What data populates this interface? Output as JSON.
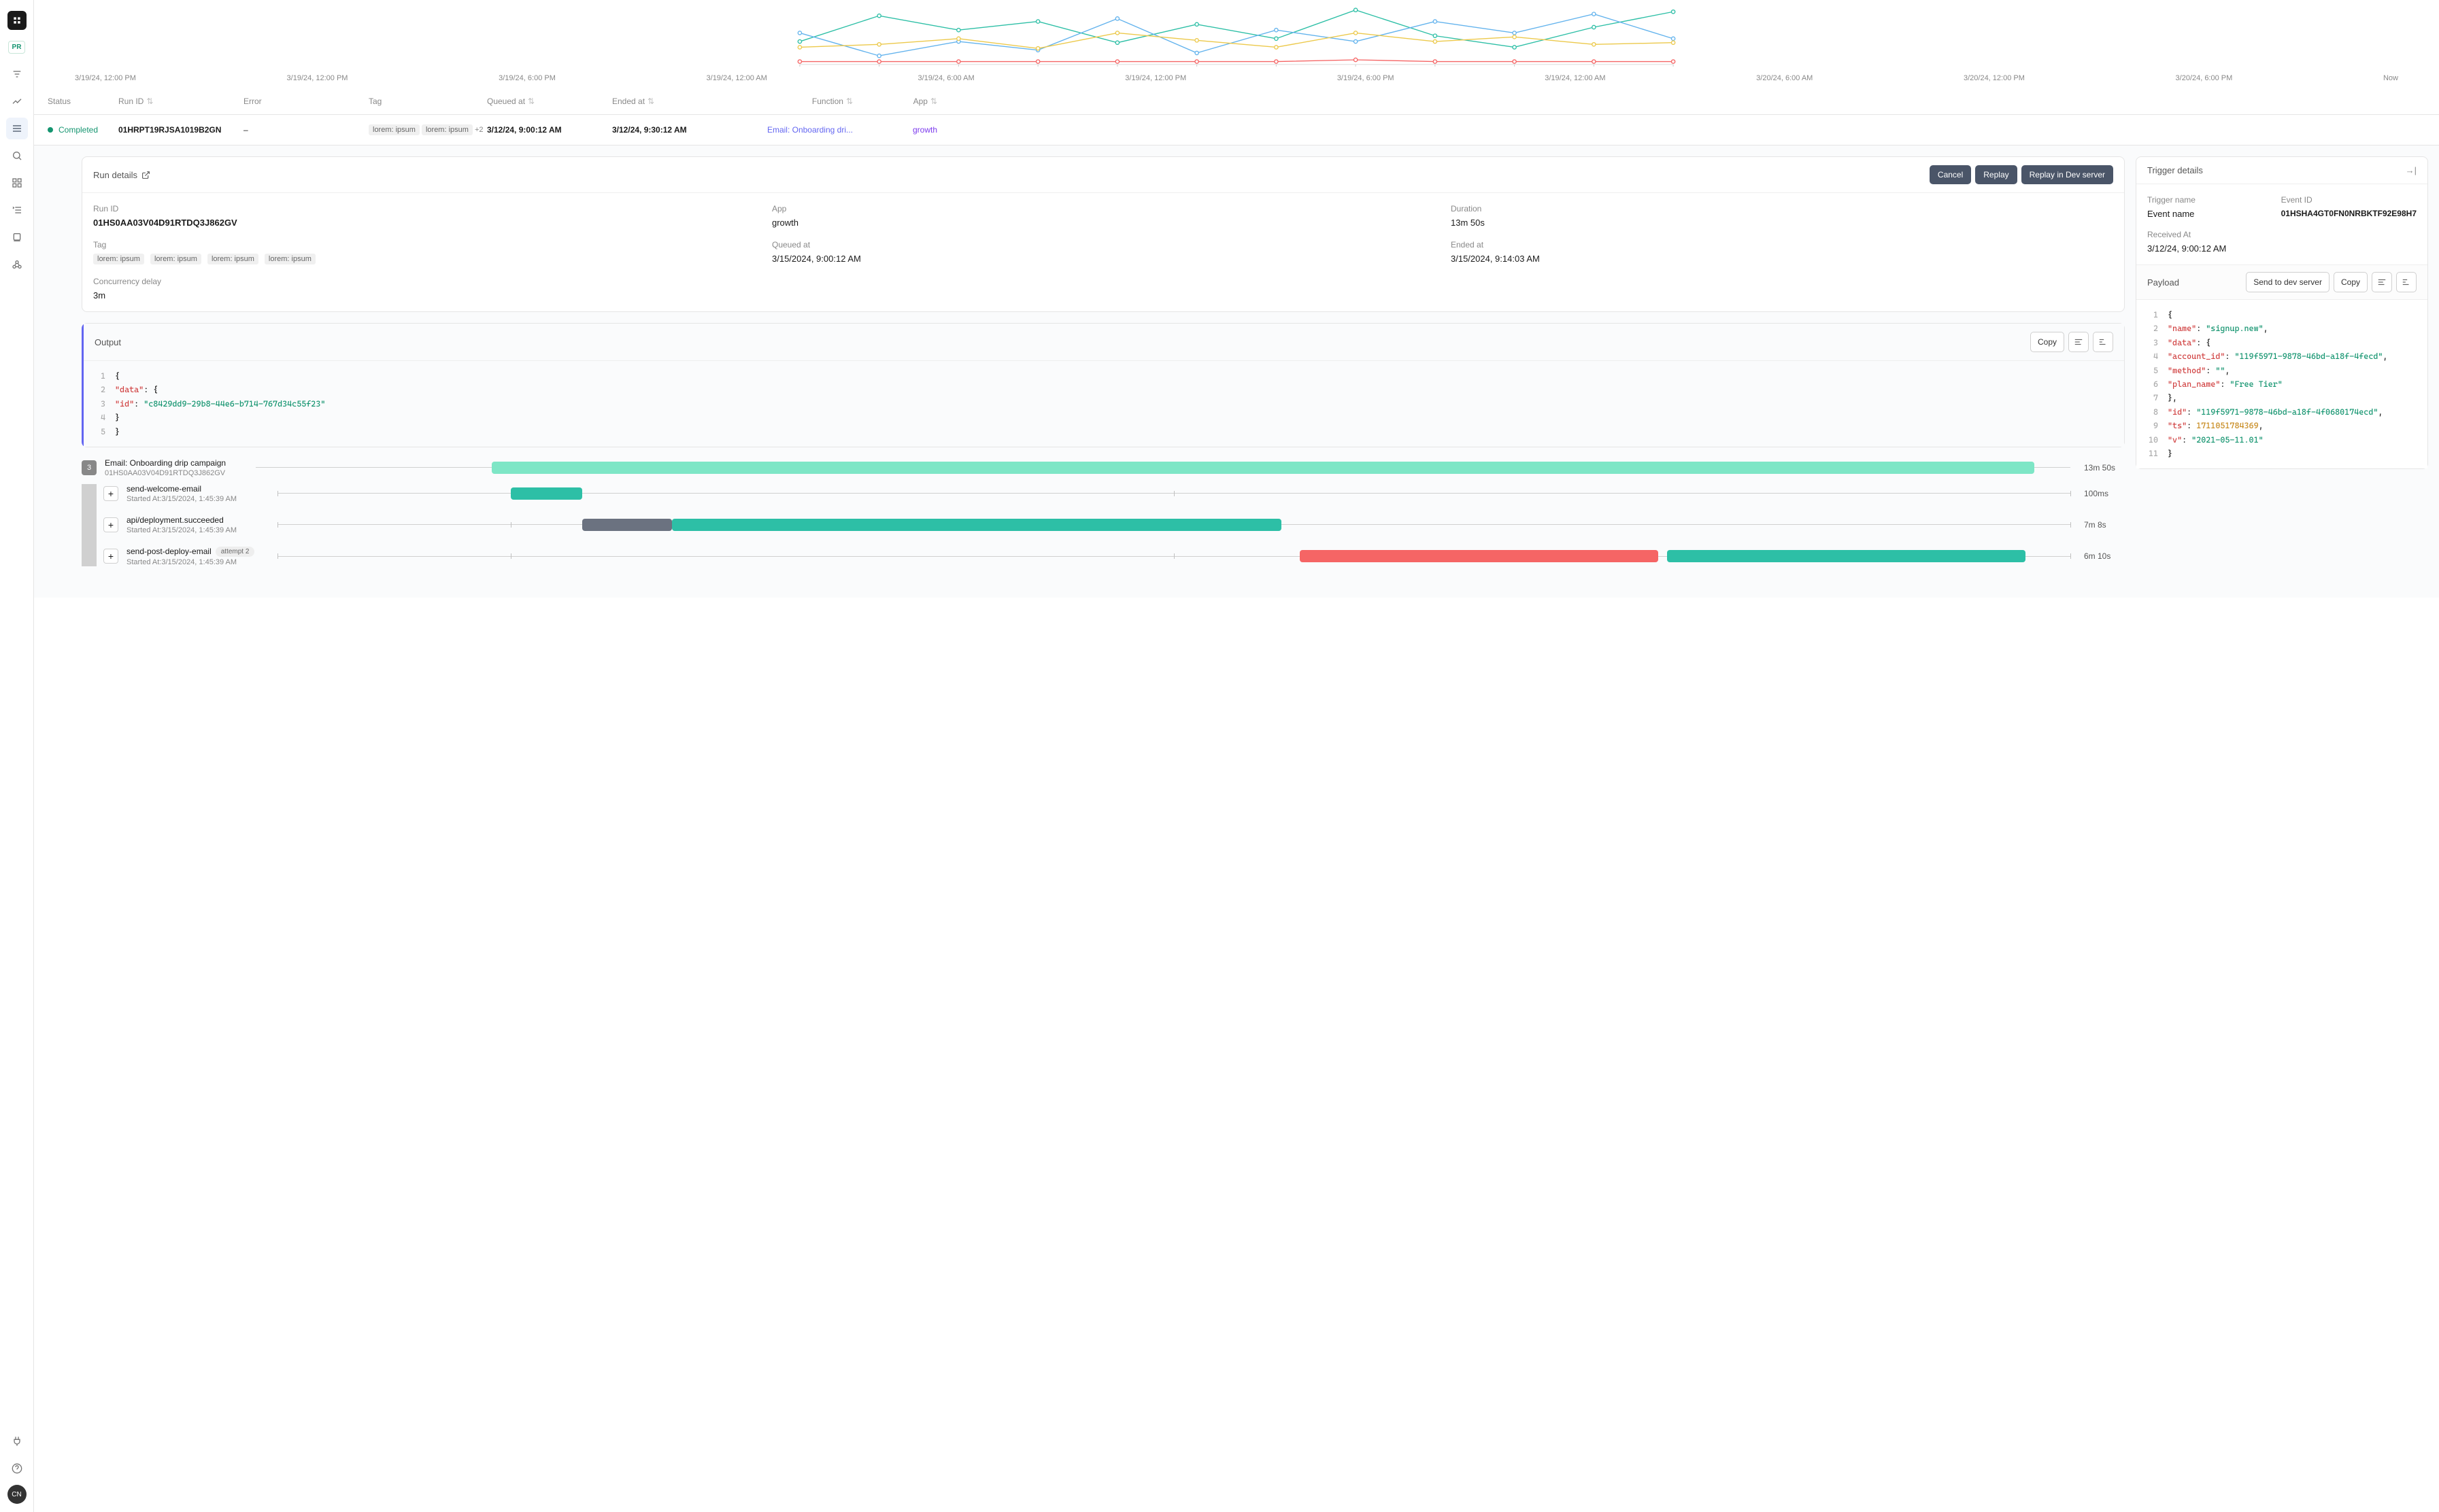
{
  "sidebar": {
    "pr_badge": "PR",
    "avatar": "CN"
  },
  "chart_data": {
    "type": "line",
    "xlabels": [
      "3/19/24, 12:00 PM",
      "3/19/24, 12:00 PM",
      "3/19/24, 6:00 PM",
      "3/19/24, 12:00 AM",
      "3/19/24, 6:00 AM",
      "3/19/24, 12:00 PM",
      "3/19/24, 6:00 PM",
      "3/19/24, 12:00 AM",
      "3/20/24, 6:00 AM",
      "3/20/24, 12:00 PM",
      "3/20/24, 6:00 PM",
      "Now"
    ],
    "series": [
      {
        "name": "teal",
        "color": "#2dbfa6",
        "values": [
          40,
          85,
          60,
          75,
          38,
          70,
          45,
          95,
          50,
          30,
          65,
          92
        ]
      },
      {
        "name": "blue",
        "color": "#63b3ed",
        "values": [
          55,
          15,
          40,
          25,
          80,
          20,
          60,
          40,
          75,
          55,
          88,
          45
        ]
      },
      {
        "name": "yellow",
        "color": "#ecc94b",
        "values": [
          30,
          35,
          45,
          28,
          55,
          42,
          30,
          55,
          40,
          48,
          35,
          38
        ]
      },
      {
        "name": "red",
        "color": "#f56565",
        "values": [
          5,
          5,
          5,
          5,
          5,
          5,
          5,
          8,
          5,
          5,
          5,
          5
        ]
      }
    ],
    "ylim": [
      0,
      100
    ]
  },
  "table": {
    "headers": {
      "status": "Status",
      "run_id": "Run ID",
      "error": "Error",
      "tag": "Tag",
      "queued_at": "Queued at",
      "ended_at": "Ended at",
      "function": "Function",
      "app": "App"
    },
    "row": {
      "status": "Completed",
      "run_id": "01HRPT19RJSA1019B2GN",
      "error": "–",
      "tags": [
        "lorem: ipsum",
        "lorem: ipsum"
      ],
      "tag_more": "+2",
      "queued_at": "3/12/24, 9:00:12 AM",
      "ended_at": "3/12/24, 9:30:12 AM",
      "function": "Email: Onboarding dri...",
      "app": "growth"
    }
  },
  "run_details": {
    "title": "Run details",
    "buttons": {
      "cancel": "Cancel",
      "replay": "Replay",
      "replay_dev": "Replay in Dev server"
    },
    "run_id_label": "Run ID",
    "run_id": "01HS0AA03V04D91RTDQ3J862GV",
    "app_label": "App",
    "app": "growth",
    "duration_label": "Duration",
    "duration": "13m 50s",
    "tag_label": "Tag",
    "tags": [
      "lorem: ipsum",
      "lorem: ipsum",
      "lorem: ipsum",
      "lorem: ipsum"
    ],
    "queued_label": "Queued at",
    "queued": "3/15/2024, 9:00:12 AM",
    "ended_label": "Ended at",
    "ended": "3/15/2024, 9:14:03 AM",
    "concurrency_label": "Concurrency delay",
    "concurrency": "3m"
  },
  "output": {
    "title": "Output",
    "copy": "Copy",
    "lines": [
      [
        {
          "t": "{",
          "c": "brace"
        }
      ],
      [
        {
          "t": "  \"data\"",
          "c": "key"
        },
        {
          "t": ": ",
          "c": "brace"
        },
        {
          "t": "{",
          "c": "brace"
        }
      ],
      [
        {
          "t": "    \"id\"",
          "c": "key"
        },
        {
          "t": ": ",
          "c": "brace"
        },
        {
          "t": "\"c8429dd9-29b8-44e6-b714-767d34c55f23\"",
          "c": "str"
        }
      ],
      [
        {
          "t": "  }",
          "c": "brace"
        }
      ],
      [
        {
          "t": "}",
          "c": "brace"
        }
      ]
    ]
  },
  "timeline": {
    "root": {
      "count": "3",
      "name": "Email: Onboarding drip campaign",
      "sub": "01HS0AA03V04D91RTDQ3J862GV",
      "duration": "13m 50s",
      "bar": {
        "left": 13,
        "width": 85,
        "color": "#7ee6c6"
      }
    },
    "children": [
      {
        "name": "send-welcome-email",
        "sub": "Started At:3/15/2024, 1:45:39 AM",
        "duration": "100ms",
        "bars": [
          {
            "left": 13,
            "width": 4,
            "color": "#2dbfa6"
          }
        ]
      },
      {
        "name": "api/deployment.succeeded",
        "sub": "Started At:3/15/2024, 1:45:39 AM",
        "duration": "7m 8s",
        "bars": [
          {
            "left": 17,
            "width": 5,
            "color": "#6b7280"
          },
          {
            "left": 22,
            "width": 34,
            "color": "#2dbfa6"
          }
        ]
      },
      {
        "name": "send-post-deploy-email",
        "sub": "Started At:3/15/2024, 1:45:39 AM",
        "duration": "6m 10s",
        "attempt_label": "attempt",
        "attempt": "2",
        "bars": [
          {
            "left": 57,
            "width": 20,
            "color": "#f56565"
          },
          {
            "left": 77.5,
            "width": 20,
            "color": "#2dbfa6"
          }
        ]
      }
    ]
  },
  "trigger": {
    "title": "Trigger details",
    "name_label": "Trigger name",
    "name": "Event name",
    "event_id_label": "Event ID",
    "event_id": "01HSHA4GT0FN0NRBKTF92E98H7",
    "received_label": "Received At",
    "received": "3/12/24, 9:00:12 AM"
  },
  "payload": {
    "title": "Payload",
    "send": "Send to dev server",
    "copy": "Copy",
    "lines": [
      [
        {
          "t": "{",
          "c": "brace"
        }
      ],
      [
        {
          "t": "  \"name\"",
          "c": "key"
        },
        {
          "t": ": ",
          "c": "brace"
        },
        {
          "t": "\"signup.new\"",
          "c": "str"
        },
        {
          "t": ",",
          "c": "brace"
        }
      ],
      [
        {
          "t": "  \"data\"",
          "c": "key"
        },
        {
          "t": ": ",
          "c": "brace"
        },
        {
          "t": "{",
          "c": "brace"
        }
      ],
      [
        {
          "t": "    \"account_id\"",
          "c": "key"
        },
        {
          "t": ": ",
          "c": "brace"
        },
        {
          "t": "\"119f5971-9878-46bd-a18f-4fecd\"",
          "c": "str"
        },
        {
          "t": ",",
          "c": "brace"
        }
      ],
      [
        {
          "t": "    \"method\"",
          "c": "key"
        },
        {
          "t": ": ",
          "c": "brace"
        },
        {
          "t": "\"\"",
          "c": "str"
        },
        {
          "t": ",",
          "c": "brace"
        }
      ],
      [
        {
          "t": "    \"plan_name\"",
          "c": "key"
        },
        {
          "t": ": ",
          "c": "brace"
        },
        {
          "t": "\"Free Tier\"",
          "c": "str"
        }
      ],
      [
        {
          "t": "  }",
          "c": "brace"
        },
        {
          "t": ",",
          "c": "brace"
        }
      ],
      [
        {
          "t": "  \"id\"",
          "c": "key"
        },
        {
          "t": ": ",
          "c": "brace"
        },
        {
          "t": "\"119f5971-9878-46bd-a18f-4f0680174ecd\"",
          "c": "str"
        },
        {
          "t": ",",
          "c": "brace"
        }
      ],
      [
        {
          "t": "  \"ts\"",
          "c": "key"
        },
        {
          "t": ": ",
          "c": "brace"
        },
        {
          "t": "1711051784369",
          "c": "num"
        },
        {
          "t": ",",
          "c": "brace"
        }
      ],
      [
        {
          "t": "  \"v\"",
          "c": "key"
        },
        {
          "t": ": ",
          "c": "brace"
        },
        {
          "t": "\"2021-05-11.01\"",
          "c": "str"
        }
      ],
      [
        {
          "t": "}",
          "c": "brace"
        }
      ]
    ]
  }
}
